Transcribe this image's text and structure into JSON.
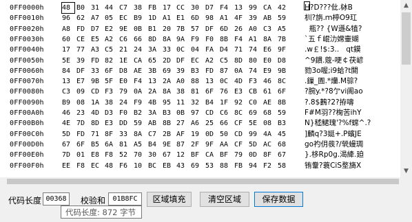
{
  "rows": [
    {
      "addr": "0FF0000h",
      "bytes": [
        "48",
        "B0",
        "31",
        "44",
        "C7",
        "38",
        "FB",
        "17",
        "CC",
        "30",
        "D7",
        "F4",
        "13",
        "99",
        "CA",
        "42"
      ],
      "ascii": "H?D???仳.栤B"
    },
    {
      "addr": "0FF0010h",
      "bytes": [
        "96",
        "62",
        "A7",
        "05",
        "EC",
        "B9",
        "1D",
        "A1",
        "E1",
        "6D",
        "98",
        "A1",
        "4F",
        "39",
        "AB",
        "59"
      ],
      "ascii": "杊?旃.ｍ楟O9玒"
    },
    {
      "addr": "0FF0020h",
      "bytes": [
        "A8",
        "FD",
        "D7",
        "E2",
        "9E",
        "0B",
        "B1",
        "20",
        "7B",
        "57",
        "DF",
        "6D",
        "26",
        "A0",
        "C3",
        "A5"
      ],
      "ascii": "  瓶?? {W遜&犆?"
    },
    {
      "addr": "0FF0030h",
      "bytes": [
        "60",
        "CE",
        "E5",
        "A2",
        "C6",
        "66",
        "8D",
        "8A",
        "9A",
        "F9",
        "F0",
        "8B",
        "F4",
        "A1",
        "8A",
        "7B"
      ],
      "ascii": "`五ｆ崐氻嫦壷媩"
    },
    {
      "addr": "0FF0040h",
      "bytes": [
        "17",
        "77",
        "A3",
        "C5",
        "21",
        "24",
        "3A",
        "33",
        "0C",
        "04",
        "FA",
        "D4",
        "71",
        "74",
        "E6",
        "9F"
      ],
      "ascii": ".w￡!$:3..   qt鏌"
    },
    {
      "addr": "0FF0050h",
      "bytes": [
        "5E",
        "39",
        "FD",
        "82",
        "1E",
        "CA",
        "65",
        "2D",
        "DF",
        "EC",
        "A2",
        "C5",
        "8D",
        "80",
        "E0",
        "D8"
      ],
      "ascii": "^9鏆.蔲-哽￠茯嵃"
    },
    {
      "addr": "0FF0060h",
      "bytes": [
        "84",
        "DF",
        "33",
        "6F",
        "D8",
        "AE",
        "3B",
        "69",
        "39",
        "B3",
        "FD",
        "87",
        "0A",
        "74",
        "E9",
        "9B"
      ],
      "ascii": "勠3o喔;i9蛤?t閞"
    },
    {
      "addr": "0FF0070h",
      "bytes": [
        "13",
        "E7",
        "9B",
        "5F",
        "E0",
        "F4",
        "13",
        "2A",
        "A0",
        "88",
        "13",
        "0C",
        "4D",
        "F3",
        "46",
        "8C"
      ],
      "ascii": ".鏁_圊.*爤.M骔?"
    },
    {
      "addr": "0FF0080h",
      "bytes": [
        "C3",
        "09",
        "CD",
        "F3",
        "79",
        "0A",
        "2A",
        "8A",
        "38",
        "81",
        "6F",
        "76",
        "E3",
        "CB",
        "61",
        "6F"
      ],
      "ascii": "?腕y.*?8亇vi阓ao"
    },
    {
      "addr": "0FF0090h",
      "bytes": [
        "B9",
        "08",
        "1A",
        "38",
        "24",
        "F9",
        "4B",
        "95",
        "11",
        "32",
        "B4",
        "1F",
        "92",
        "C0",
        "AE",
        "8B"
      ],
      "ascii": "?.8$鶈?2?拵嚋"
    },
    {
      "addr": "0FF00A0h",
      "bytes": [
        "46",
        "23",
        "4D",
        "D3",
        "F0",
        "B2",
        "3A",
        "B3",
        "0B",
        "97",
        "CD",
        "C6",
        "8C",
        "69",
        "68",
        "59"
      ],
      "ascii": "F#M羽??椈苦ihY"
    },
    {
      "addr": "0FF00B0h",
      "bytes": [
        "4E",
        "7D",
        "8D",
        "E3",
        "DD",
        "59",
        "AB",
        "8B",
        "27",
        "A6",
        "25",
        "66",
        "CF",
        "5E",
        "08",
        "B3"
      ],
      "ascii": "N}嵇鮶瑰'?%f蟐^.?"
    },
    {
      "addr": "0FF00C0h",
      "bytes": [
        "5D",
        "FD",
        "71",
        "8F",
        "33",
        "8A",
        "C7",
        "2B",
        "AF",
        "19",
        "0D",
        "50",
        "CD",
        "99",
        "4A",
        "45"
      ],
      "ascii": "]麟q?3娗+.P蠙JE"
    },
    {
      "addr": "0FF00D0h",
      "bytes": [
        "67",
        "6F",
        "B5",
        "6A",
        "81",
        "A5",
        "B4",
        "9E",
        "87",
        "2F",
        "9F",
        "AA",
        "CF",
        "5D",
        "AC",
        "68"
      ],
      "ascii": "go礿仴彂?/煢蟃琱"
    },
    {
      "addr": "0FF00E0h",
      "bytes": [
        "7D",
        "01",
        "E8",
        "F8",
        "52",
        "70",
        "30",
        "67",
        "12",
        "BF",
        "CA",
        "BF",
        "79",
        "0D",
        "8F",
        "67"
      ],
      "ascii": "}.栘Rp0g.渴縴.廹"
    },
    {
      "addr": "0FF00F0h",
      "bytes": [
        "EE",
        "F8",
        "EC",
        "48",
        "F6",
        "10",
        "BC",
        "EB",
        "43",
        "69",
        "53",
        "88",
        "FB",
        "94",
        "F2",
        "58"
      ],
      "ascii": "铕韏?蓑CiS堥旖X"
    }
  ],
  "footer": {
    "code_len_label": "代码长度",
    "code_len_value": "00368",
    "checksum_label": "校验和",
    "checksum_value": "01B8FC",
    "fill_button": "区域填充",
    "clear_button": "清空区域",
    "save_button": "保存数据"
  },
  "tooltip": "代码长度: 872 字节",
  "scroll": {
    "position_fraction": 0.0
  }
}
